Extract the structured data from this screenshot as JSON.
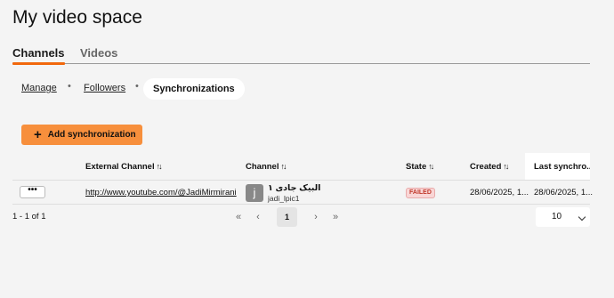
{
  "page": {
    "title": "My video space"
  },
  "main_tabs": [
    {
      "label": "Channels",
      "active": true
    },
    {
      "label": "Videos",
      "active": false
    }
  ],
  "subnav": {
    "items": [
      {
        "label": "Manage"
      },
      {
        "label": "Followers"
      },
      {
        "label": "Synchronizations",
        "active": true
      }
    ],
    "separator": "•"
  },
  "actions": {
    "add_sync_label": "Add synchronization",
    "add_icon": "plus-icon"
  },
  "table": {
    "sort_glyph": "↑↓",
    "columns": [
      {
        "label": "External Channel",
        "sortable": true
      },
      {
        "label": "Channel",
        "sortable": true
      },
      {
        "label": "State",
        "sortable": true
      },
      {
        "label": "Created",
        "sortable": true
      },
      {
        "label": "Last synchro...",
        "sortable": false
      }
    ],
    "rows": [
      {
        "more_label": "•••",
        "external_channel": "http://www.youtube.com/@JadiMirmirani",
        "channel_avatar_letter": "j",
        "channel_name": "البیک جادی ۱",
        "channel_handle": "jadi_lpic1",
        "state": "FAILED",
        "created": "28/06/2025, 1...",
        "last_sync": "28/06/2025, 1..."
      }
    ]
  },
  "pagination": {
    "count_text": "1 - 1 of 1",
    "first_glyph": "«",
    "prev_glyph": "‹",
    "current_page": "1",
    "next_glyph": "›",
    "last_glyph": "»",
    "page_size": "10"
  },
  "colors": {
    "accent": "#f1680d",
    "button": "#f78f3c",
    "failed_bg": "#f9d6d6",
    "failed_text": "#c0392b",
    "background": "#f4f4f4"
  }
}
